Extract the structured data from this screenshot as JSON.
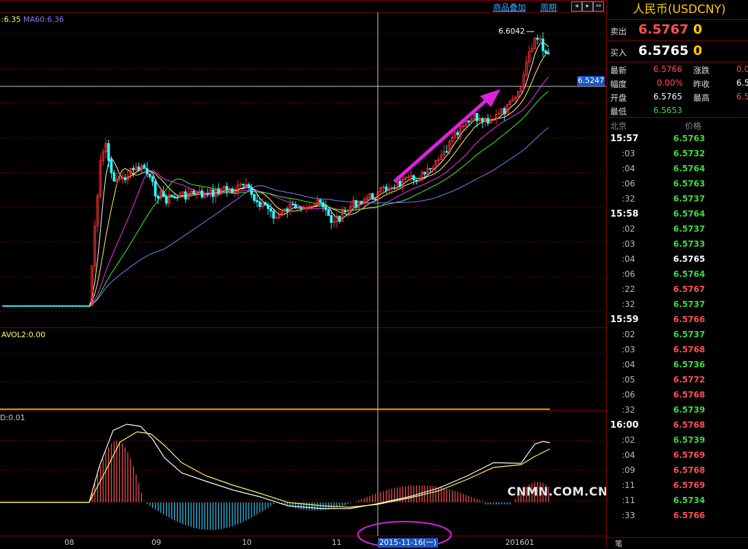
{
  "toolbar": {
    "overlay_label": "商品叠加",
    "period_label": "周期"
  },
  "legends": {
    "ma_main": ":6.35",
    "ma60": "MA60:6.36",
    "vol": "AVOL2:0.00",
    "macd": "D:0.01"
  },
  "price_annotation": "6.6042",
  "crosshair_price": "6.5247",
  "crosshair_date": "2015-11-16(一)",
  "x_labels": [
    "08",
    "09",
    "10",
    "11",
    "201601"
  ],
  "watermark": "CNMN.COM.CN",
  "panel": {
    "title": "人民币(USDCNY)",
    "sell_label": "卖出",
    "sell_price": "6.5767",
    "sell_qty": "0",
    "buy_label": "买入",
    "buy_price": "6.5765",
    "buy_qty": "0",
    "stats": {
      "latest_label": "最新",
      "latest": "6.5766",
      "change_label": "涨跌",
      "change": "0.0",
      "amp_label": "幅度",
      "amp": "0.00%",
      "prev_label": "昨收",
      "prev": "6.5",
      "open_label": "开盘",
      "open": "6.5765",
      "high_label": "最高",
      "high": "6.5",
      "low_label": "最低",
      "low": "6.5653"
    },
    "tick_header_time": "北京",
    "tick_header_price": "价格",
    "ticks": [
      {
        "t": "15:57",
        "p": "6.5763",
        "c": "green",
        "m": true
      },
      {
        "t": ":03",
        "p": "6.5732",
        "c": "green",
        "m": false
      },
      {
        "t": ":04",
        "p": "6.5764",
        "c": "green",
        "m": false
      },
      {
        "t": ":06",
        "p": "6.5763",
        "c": "green",
        "m": false
      },
      {
        "t": ":32",
        "p": "6.5737",
        "c": "green",
        "m": false
      },
      {
        "t": "15:58",
        "p": "6.5764",
        "c": "green",
        "m": true
      },
      {
        "t": ":02",
        "p": "6.5737",
        "c": "green",
        "m": false
      },
      {
        "t": ":03",
        "p": "6.5733",
        "c": "green",
        "m": false
      },
      {
        "t": ":04",
        "p": "6.5765",
        "c": "white",
        "m": false
      },
      {
        "t": ":06",
        "p": "6.5764",
        "c": "green",
        "m": false
      },
      {
        "t": ":22",
        "p": "6.5767",
        "c": "red",
        "m": false
      },
      {
        "t": ":32",
        "p": "6.5737",
        "c": "green",
        "m": false
      },
      {
        "t": "15:59",
        "p": "6.5766",
        "c": "red",
        "m": true
      },
      {
        "t": ":02",
        "p": "6.5737",
        "c": "green",
        "m": false
      },
      {
        "t": ":03",
        "p": "6.5768",
        "c": "red",
        "m": false
      },
      {
        "t": ":04",
        "p": "6.5736",
        "c": "green",
        "m": false
      },
      {
        "t": ":05",
        "p": "6.5772",
        "c": "red",
        "m": false
      },
      {
        "t": ":06",
        "p": "6.5768",
        "c": "red",
        "m": false
      },
      {
        "t": ":32",
        "p": "6.5739",
        "c": "green",
        "m": false
      },
      {
        "t": "16:00",
        "p": "6.5768",
        "c": "red",
        "m": true
      },
      {
        "t": ":02",
        "p": "6.5739",
        "c": "green",
        "m": false
      },
      {
        "t": ":04",
        "p": "6.5769",
        "c": "red",
        "m": false
      },
      {
        "t": ":09",
        "p": "6.5768",
        "c": "red",
        "m": false
      },
      {
        "t": ":11",
        "p": "6.5769",
        "c": "red",
        "m": false
      },
      {
        "t": ":11",
        "p": "6.5734",
        "c": "green",
        "m": false
      },
      {
        "t": ":33",
        "p": "6.5766",
        "c": "red",
        "m": false
      }
    ],
    "bottom_tab": "笔"
  },
  "colors": {
    "up": "#ff5050",
    "down": "#3ddc3d",
    "up_candle": "#ff3333",
    "down_candle": "#33ffff",
    "ma5": "#ffffff",
    "ma10": "#ffff66",
    "ma20": "#ff33ff",
    "ma30": "#33ff33",
    "ma60": "#8080ff",
    "grid": "#8b0000",
    "trend_arrow": "#e020e0"
  }
}
